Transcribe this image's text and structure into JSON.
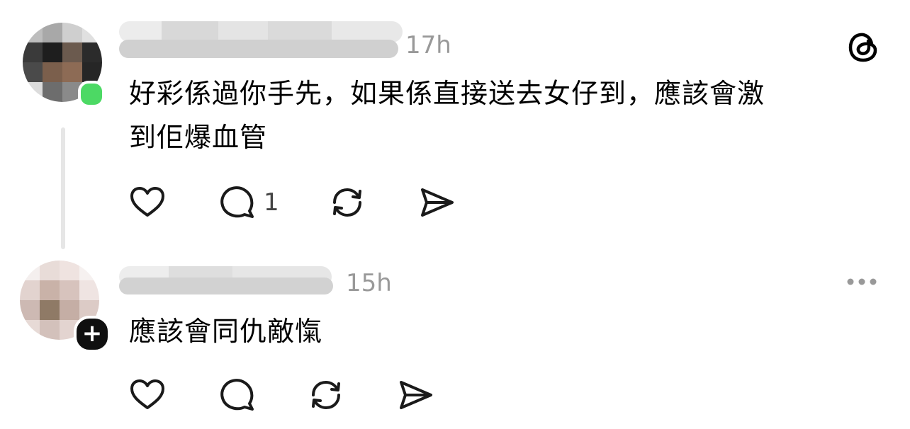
{
  "comments": [
    {
      "timestamp": "17h",
      "text": "好彩係過你手先，如果係直接送去女仔到，應該會激到佢爆血管",
      "text_line1": "好彩係過你手先，如果係直接送去女仔到，應該會激",
      "text_line2": "到佢爆血管",
      "reply_count": "1",
      "status": "online",
      "top_right_icon": "threads-logo-icon"
    },
    {
      "timestamp": "15h",
      "text": "應該會同仇敵愾",
      "reply_count": "",
      "status": "follow",
      "follow_symbol": "+",
      "top_right_icon": "more-options-icon"
    }
  ],
  "colors": {
    "online": "#4cd964",
    "timestamp": "#999999",
    "thread_line": "#e6e6e6",
    "icon_stroke": "#1a1a1a"
  },
  "icons": [
    "heart-icon",
    "comment-icon",
    "repost-icon",
    "share-icon"
  ]
}
